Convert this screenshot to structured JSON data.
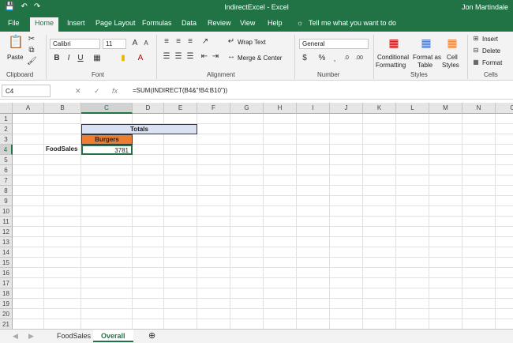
{
  "window": {
    "title": "IndirectExcel  -  Excel",
    "user": "Jon Martindale"
  },
  "qat": {
    "save_icon": "save-icon",
    "undo_icon": "undo-icon",
    "redo_icon": "redo-icon"
  },
  "tabs": [
    {
      "label": "File"
    },
    {
      "label": "Home"
    },
    {
      "label": "Insert"
    },
    {
      "label": "Page Layout"
    },
    {
      "label": "Formulas"
    },
    {
      "label": "Data"
    },
    {
      "label": "Review"
    },
    {
      "label": "View"
    },
    {
      "label": "Help"
    },
    {
      "label": "Tell me what you want to do"
    }
  ],
  "ribbon": {
    "clipboard": {
      "label": "Clipboard",
      "paste": "Paste"
    },
    "font": {
      "label": "Font",
      "name": "Calibri",
      "size": "11"
    },
    "alignment": {
      "label": "Alignment",
      "wrap": "Wrap Text",
      "merge": "Merge & Center"
    },
    "number": {
      "label": "Number",
      "format": "General"
    },
    "styles": {
      "label": "Styles",
      "conditional": "Conditional",
      "formatting": "Formatting",
      "format_as": "Format as",
      "table": "Table",
      "cell": "Cell",
      "styles_btn": "Styles"
    },
    "cells": {
      "label": "Cells",
      "insert": "Insert",
      "delete": "Delete",
      "format": "Format"
    }
  },
  "formula_bar": {
    "name_box": "C4",
    "formula": "=SUM(INDIRECT(B4&\"!B4:B10\"))"
  },
  "columns": [
    "A",
    "B",
    "C",
    "D",
    "E",
    "F",
    "G",
    "H",
    "I",
    "J",
    "K",
    "L",
    "M",
    "N",
    "O"
  ],
  "rows": [
    "1",
    "2",
    "3",
    "4",
    "5",
    "6",
    "7",
    "8",
    "9",
    "10",
    "11",
    "12",
    "13",
    "14",
    "15",
    "16",
    "17",
    "18",
    "19",
    "20",
    "21"
  ],
  "cells": {
    "totals": "Totals",
    "burgers": "Burgers",
    "foodsales": "FoodSales",
    "value": "3781"
  },
  "sheets": [
    {
      "label": "FoodSales"
    },
    {
      "label": "Overall"
    }
  ],
  "colors": {
    "excel_green": "#217346",
    "header_fill": "#d9e1f2",
    "burgers_fill": "#ed7d31"
  }
}
